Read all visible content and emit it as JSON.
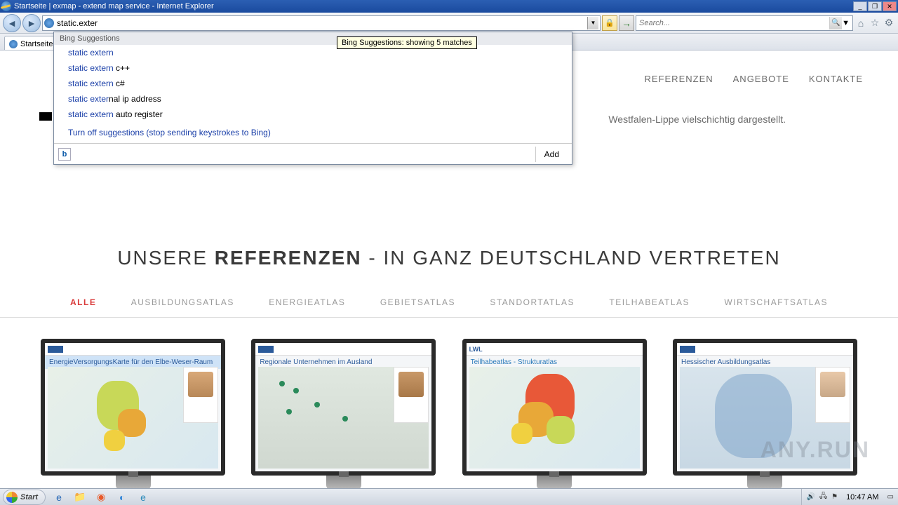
{
  "window": {
    "title": "Startseite | exmap - extend map service - Internet Explorer"
  },
  "address": {
    "value": "static.exter"
  },
  "search": {
    "placeholder": "Search..."
  },
  "tab": {
    "label": "Startseite"
  },
  "suggestions": {
    "header": "Bing Suggestions",
    "tooltip": "Bing Suggestions: showing 5 matches",
    "items": [
      {
        "match": "static extern",
        "rest": ""
      },
      {
        "match": "static extern",
        "rest": " c++"
      },
      {
        "match": "static extern",
        "rest": " c#"
      },
      {
        "match": "static exter",
        "rest": "nal ip address"
      },
      {
        "match": "static extern",
        "rest": " auto register"
      }
    ],
    "turnoff": "Turn off suggestions (stop sending keystrokes to Bing)",
    "add": "Add"
  },
  "nav": {
    "referenzen": "REFERENZEN",
    "angebote": "ANGEBOTE",
    "kontakte": "KONTAKTE"
  },
  "snippet": "Westfalen-Lippe vielschichtig dargestellt.",
  "headline": {
    "pre": "UNSERE ",
    "bold": "REFERENZEN",
    "post": " - IN GANZ DEUTSCHLAND VERTRETEN"
  },
  "filters": {
    "alle": "ALLE",
    "ausbildung": "AUSBILDUNGSATLAS",
    "energie": "ENERGIEATLAS",
    "gebiet": "GEBIETSATLAS",
    "standort": "STANDORTATLAS",
    "teilhabe": "TEILHABEATLAS",
    "wirtschaft": "WIRTSCHAFTSATLAS"
  },
  "cards": [
    {
      "title": "EnergieVersorgungsKarte für den Elbe-Weser-Raum"
    },
    {
      "title": "Regionale Unternehmen im Ausland"
    },
    {
      "title": "Teilhabeatlas - Strukturatlas"
    },
    {
      "title": "Hessischer Ausbildungsatlas"
    }
  ],
  "taskbar": {
    "start": "Start",
    "clock": "10:47 AM"
  },
  "watermark": "ANY.RUN"
}
